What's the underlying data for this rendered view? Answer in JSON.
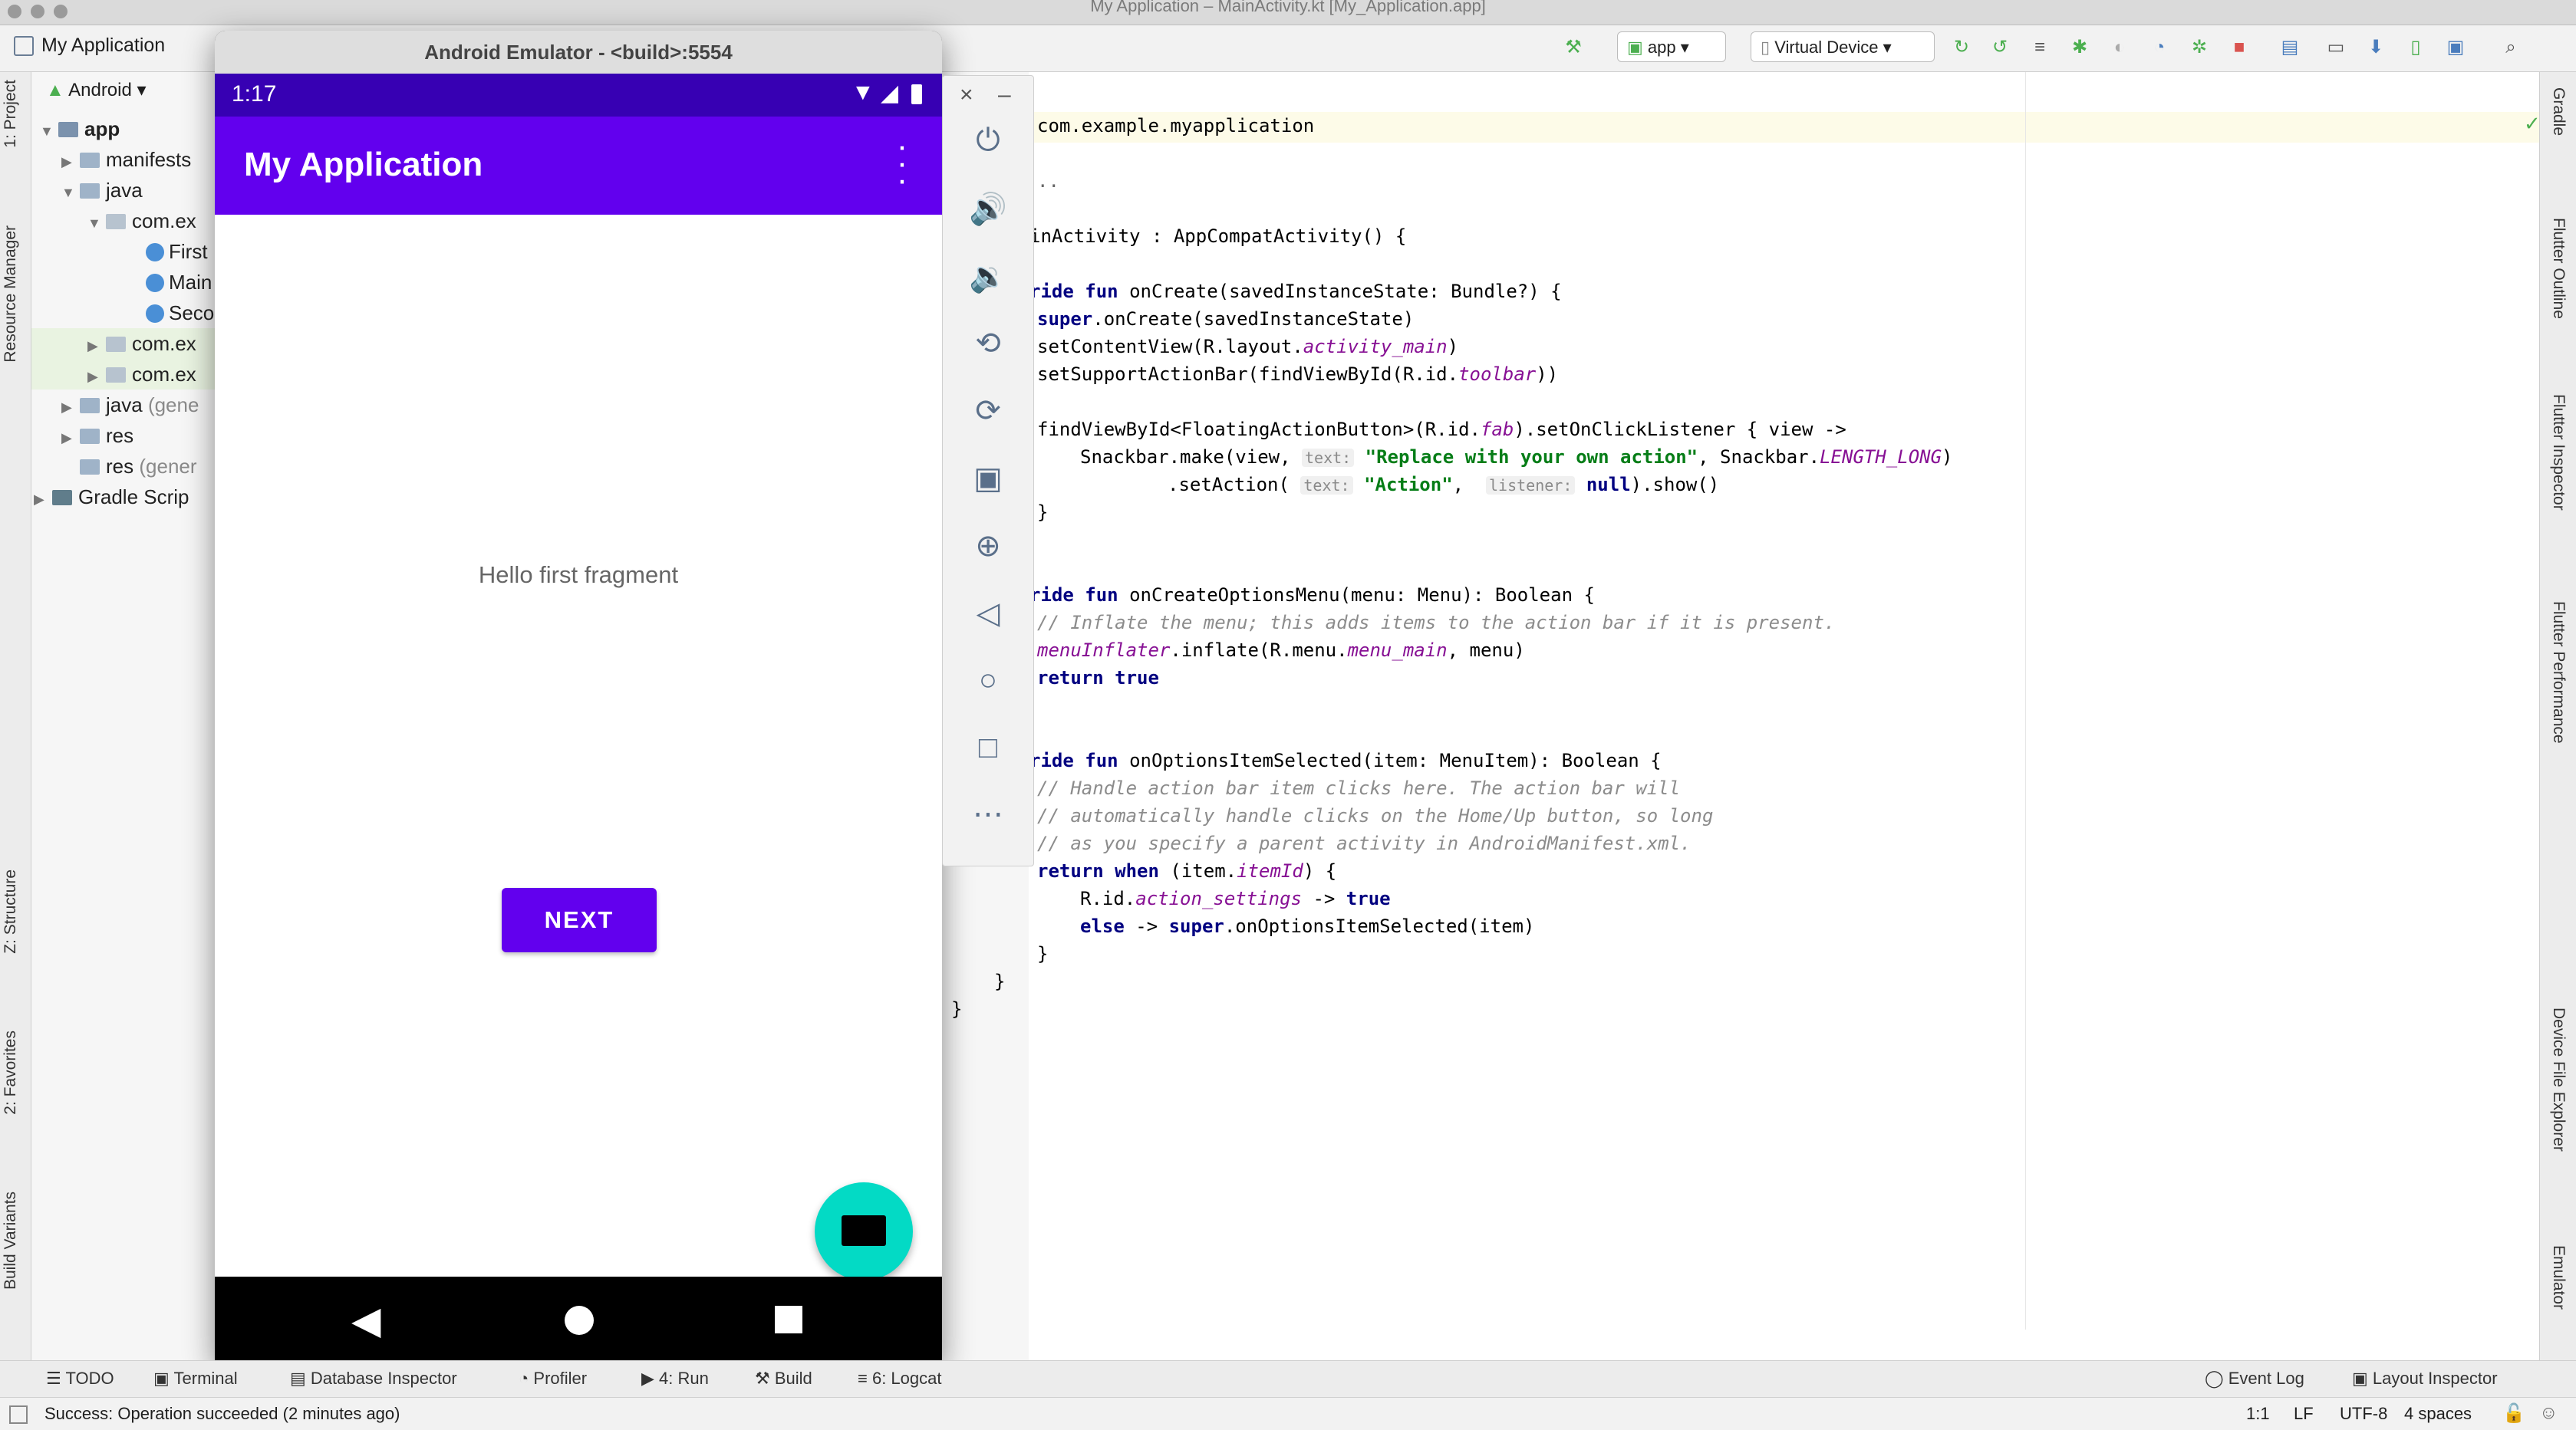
{
  "window": {
    "title": "My Application – MainActivity.kt [My_Application.app]"
  },
  "breadcrumb": {
    "label": "My Application"
  },
  "toolbar": {
    "config": "app",
    "device": "Virtual Device"
  },
  "left_tabs": [
    "1: Project",
    "Resource Manager",
    "Z: Structure",
    "2: Favorites",
    "Build Variants"
  ],
  "right_tabs": [
    "Gradle",
    "Flutter Outline",
    "Flutter Inspector",
    "Flutter Performance",
    "Device File Explorer",
    "Emulator"
  ],
  "project": {
    "view": "Android",
    "tree": [
      {
        "label": "app",
        "muted": ""
      },
      {
        "label": "manifests",
        "muted": ""
      },
      {
        "label": "java",
        "muted": ""
      },
      {
        "label": "com.ex",
        "muted": ""
      },
      {
        "label": "First",
        "muted": ""
      },
      {
        "label": "Main",
        "muted": ""
      },
      {
        "label": "Seco",
        "muted": ""
      },
      {
        "label": "com.ex",
        "muted": ""
      },
      {
        "label": "com.ex",
        "muted": ""
      },
      {
        "label": "java",
        "muted": "(gene"
      },
      {
        "label": "res",
        "muted": ""
      },
      {
        "label": "res",
        "muted": "(gener"
      },
      {
        "label": "Gradle Scrip",
        "muted": ""
      }
    ]
  },
  "emulator": {
    "title": "Android Emulator - <build>:5554",
    "time": "1:17",
    "app_title": "My Application",
    "fragment_text": "Hello first fragment",
    "next_button": "NEXT"
  },
  "code": {
    "package": "com.example.myapplication",
    "fold": "..",
    "class_decl": "inActivity : AppCompatActivity() {",
    "l_oncreate": "onCreate(savedInstanceState: Bundle?) {",
    "l_super": ".onCreate(savedInstanceState)",
    "l_setcontent_a": "setContentView(R.layout.",
    "l_setcontent_b": "activity_main",
    "l_setsupport_a": "setSupportActionBar(findViewById(R.id.",
    "l_setsupport_b": "toolbar",
    "l_find_a": "findViewById<FloatingActionButton>(R.id.",
    "l_find_b": "fab",
    "l_find_c": ").setOnClickListener { view ->",
    "l_snack_a": "Snackbar.make(view, ",
    "hint_text": "text:",
    "l_snack_str": "\"Replace with your own action\"",
    "l_snack_b": ", Snackbar.",
    "l_snack_c": "LENGTH_LONG",
    "l_action_a": ".setAction( ",
    "l_action_str": "\"Action\"",
    "hint_listener": "listener:",
    "l_action_null": "null",
    "l_action_b": ").show()",
    "l_menu": "onCreateOptionsMenu(menu: Menu): Boolean {",
    "c_inflate": "// Inflate the menu; this adds items to the action bar if it is present.",
    "l_inflater_a": "menuInflater",
    "l_inflater_b": ".inflate(R.menu.",
    "l_inflater_c": "menu_main",
    "l_inflater_d": ", menu)",
    "kw_return": "return",
    "kw_true": "true",
    "l_selected": "onOptionsItemSelected(item: MenuItem): Boolean {",
    "c1": "// Handle action bar item clicks here. The action bar will",
    "c2": "// automatically handle clicks on the Home/Up button, so long",
    "c3": "// as you specify a parent activity in AndroidManifest.xml.",
    "kw_when": "when",
    "l_when_a": "(item.",
    "l_when_b": "itemId",
    "l_when_c": ") {",
    "l_case_a": "R.id.",
    "l_case_b": "action_settings",
    "l_case_c": " -> ",
    "kw_else": "else",
    "l_else_b": ".onOptionsItemSelected(item)",
    "kw_ride": "ride",
    "kw_fun": "fun",
    "kw_super": "super",
    "brace": "}"
  },
  "bottom_tabs": [
    "TODO",
    "Terminal",
    "Database Inspector",
    "Profiler",
    "4: Run",
    "Build",
    "6: Logcat"
  ],
  "bottom_right": [
    "Event Log",
    "Layout Inspector"
  ],
  "status": {
    "message": "Success: Operation succeeded (2 minutes ago)",
    "position": "1:1",
    "line_sep": "LF",
    "encoding": "UTF-8",
    "indent": "4 spaces"
  },
  "colors": {
    "primary": "#6200ee",
    "primary_dark": "#3700b3",
    "fab": "#03dac5"
  }
}
